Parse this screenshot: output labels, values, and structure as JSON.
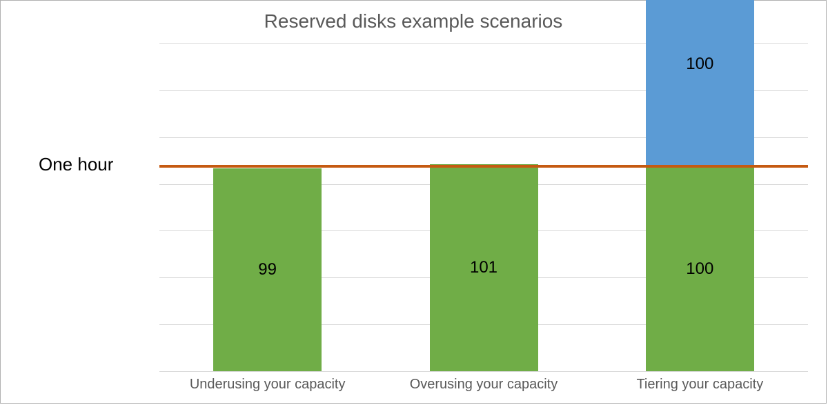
{
  "title": "Reserved disks example scenarios",
  "reference_line": {
    "label": "One hour",
    "value": 100
  },
  "colors": {
    "green": "#70ad47",
    "blue": "#5b9bd5",
    "reference": "#c55a11",
    "grid": "#d9d9d9",
    "title_text": "#595959",
    "axis_text": "#595959"
  },
  "chart_data": {
    "type": "bar",
    "title": "Reserved disks example scenarios",
    "xlabel": "",
    "ylabel": "",
    "ylim": [
      0,
      160
    ],
    "categories": [
      "Underusing your capacity",
      "Overusing your capacity",
      "Tiering your capacity"
    ],
    "series": [
      {
        "name": "green",
        "values": [
          99,
          101,
          100
        ]
      },
      {
        "name": "blue",
        "values": [
          0,
          0,
          100
        ]
      }
    ],
    "stacked": [
      [
        {
          "value": 99,
          "label": "99",
          "series": "green"
        }
      ],
      [
        {
          "value": 101,
          "label": "101",
          "series": "green"
        }
      ],
      [
        {
          "value": 100,
          "label": "100",
          "series": "green"
        },
        {
          "value": 100,
          "label": "100",
          "series": "blue"
        }
      ]
    ],
    "stacked_totals": [
      99,
      101,
      200
    ],
    "reference": {
      "label": "One hour",
      "value": 100
    },
    "gridlines_count": 8
  }
}
